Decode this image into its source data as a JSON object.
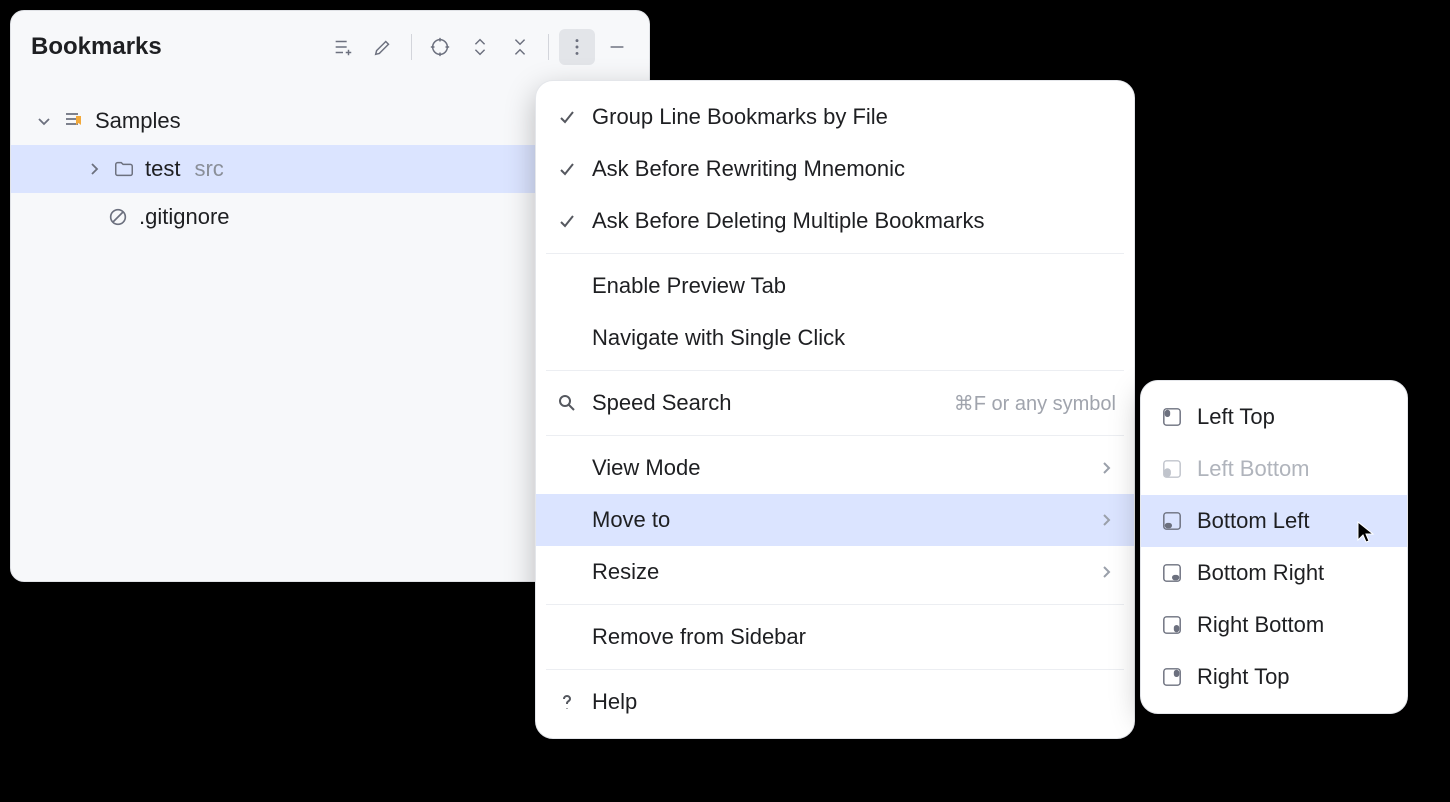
{
  "panel": {
    "title": "Bookmarks"
  },
  "tree": {
    "group": {
      "label": "Samples"
    },
    "children": [
      {
        "label": "test",
        "hint": "src"
      },
      {
        "label": ".gitignore"
      }
    ]
  },
  "menu1": {
    "items": {
      "group_by_file": "Group Line Bookmarks by File",
      "ask_rewrite": "Ask Before Rewriting Mnemonic",
      "ask_delete": "Ask Before Deleting Multiple Bookmarks",
      "enable_preview": "Enable Preview Tab",
      "nav_single": "Navigate with Single Click",
      "speed_search": "Speed Search",
      "speed_hint": "⌘F or any symbol",
      "view_mode": "View Mode",
      "move_to": "Move to",
      "resize": "Resize",
      "remove_sidebar": "Remove from Sidebar",
      "help": "Help"
    }
  },
  "menu2": {
    "left_top": "Left Top",
    "left_bottom": "Left Bottom",
    "bottom_left": "Bottom Left",
    "bottom_right": "Bottom Right",
    "right_bottom": "Right Bottom",
    "right_top": "Right Top"
  }
}
